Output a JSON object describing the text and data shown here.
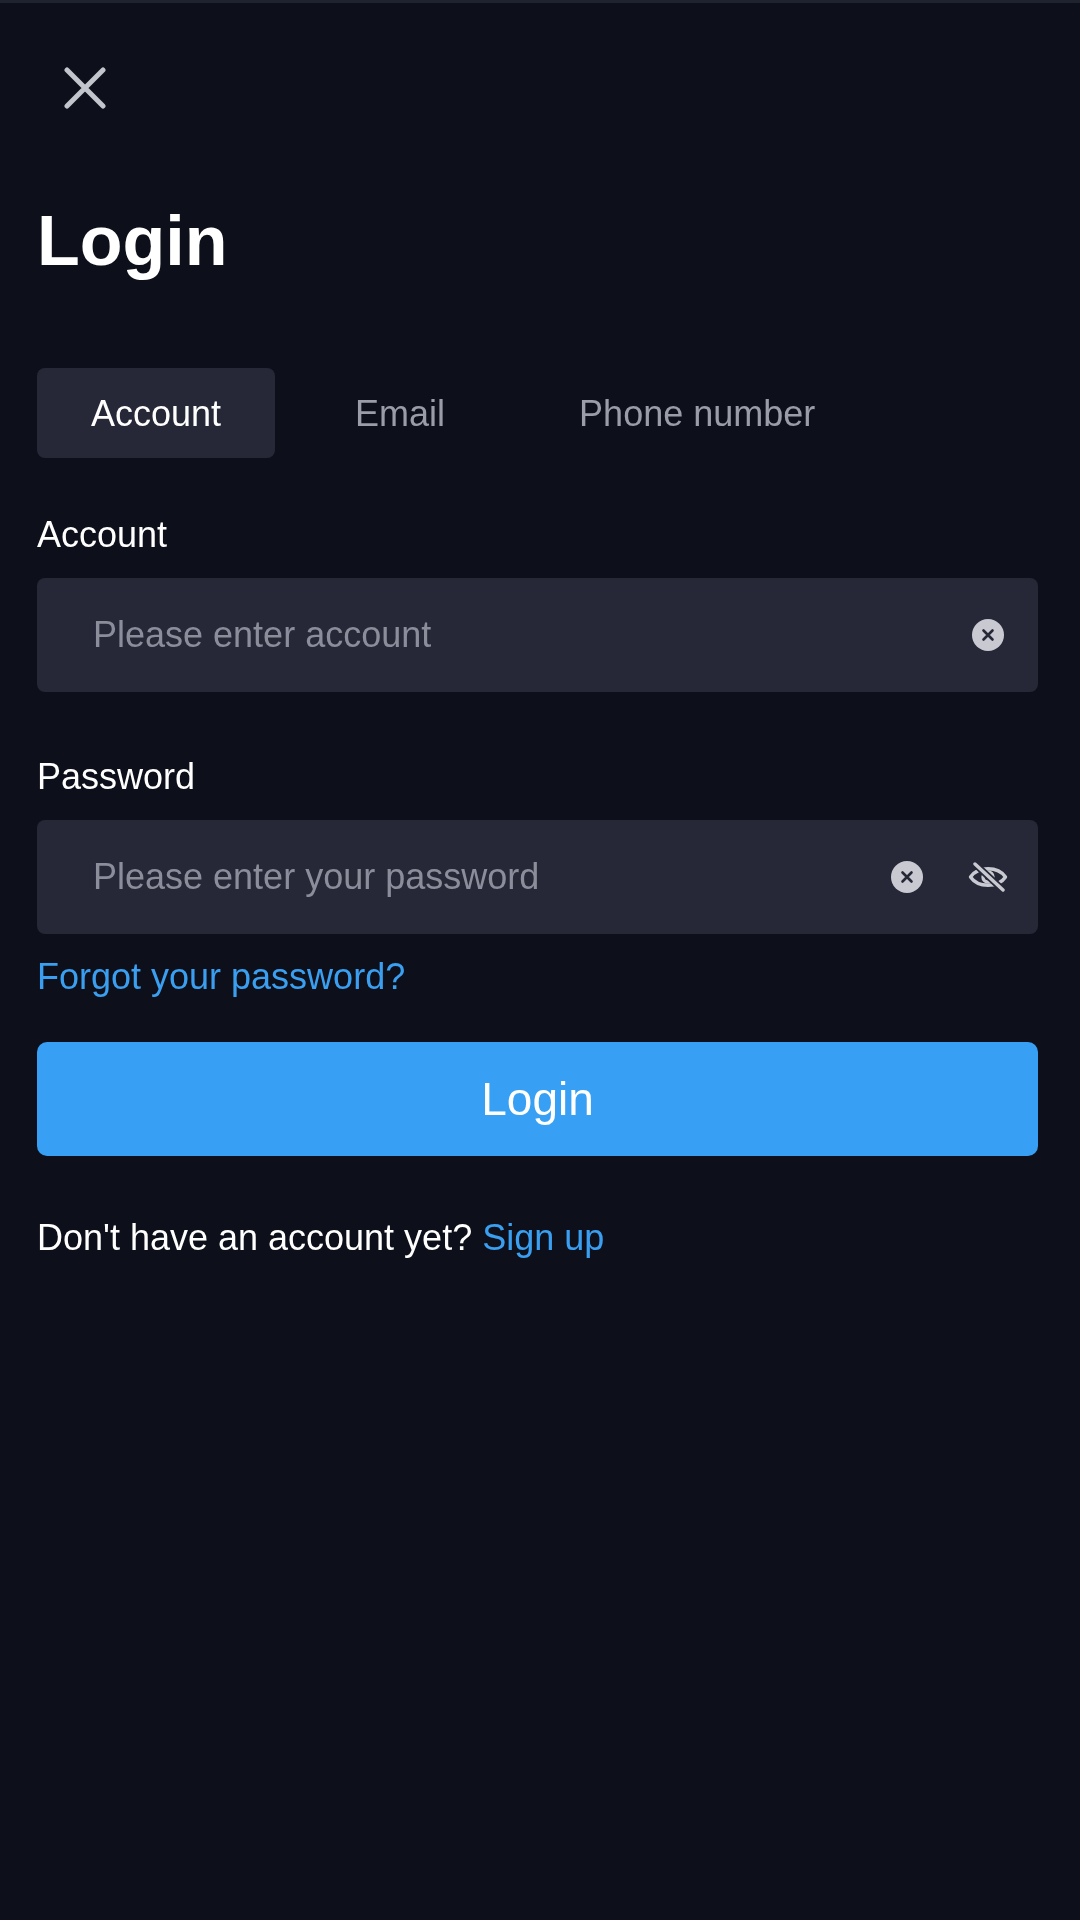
{
  "title": "Login",
  "tabs": [
    {
      "label": "Account",
      "selected": true
    },
    {
      "label": "Email",
      "selected": false
    },
    {
      "label": "Phone number",
      "selected": false
    }
  ],
  "fields": [
    {
      "kind": "text",
      "label": "Account",
      "placeholder": "Please enter account"
    },
    {
      "kind": "password",
      "label": "Password",
      "placeholder": "Please enter your password",
      "revealed": false
    }
  ],
  "forgot_link": "Forgot your password?",
  "login_button": "Login",
  "signup_prompt": {
    "text": "Don't have an account yet?",
    "link": "Sign up"
  }
}
